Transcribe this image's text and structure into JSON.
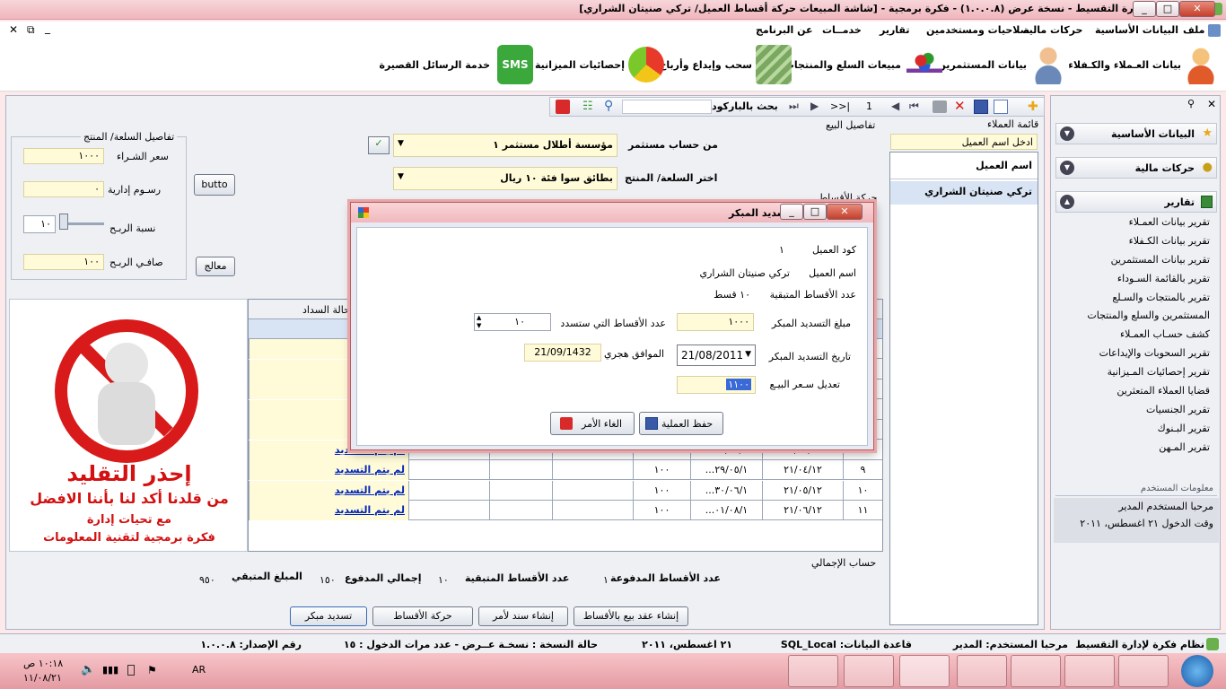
{
  "window": {
    "title": "نظام فكرة لإدارة التقسيط - نسخة عرض (١.٠.٠.٨) - فكرة برمجية - [شاشة المبيعات    حركة أقساط العميل/ تركي صنيتان الشراري]",
    "min": "_",
    "max": "□",
    "close": "✕"
  },
  "mdi_controls": {
    "close": "✕",
    "restore": "⧉",
    "min": "_"
  },
  "menu": [
    "ملف",
    "البيانات الأساسية",
    "حركات مالية",
    "صلاحيات ومستخدمين",
    "تقارير",
    "خدمــات",
    "عن البرنامج"
  ],
  "toolbar": [
    {
      "label": "بيانات العـملاء والكـفلاء",
      "icon": "customers-icon"
    },
    {
      "label": "بيانات المستثمرين",
      "icon": "investor-icon"
    },
    {
      "label": "مبيعات السلع والمنتجات",
      "icon": "cart-icon"
    },
    {
      "label": "سحب وإيداع وأرباح",
      "icon": "money-icon"
    },
    {
      "label": "إحصائيات الميزانية",
      "icon": "pie-chart-icon"
    },
    {
      "label": "خدمة الرسائل القصيرة",
      "icon": "sms-icon"
    }
  ],
  "panel_toolbar": {
    "barcode_label": "بحث بالباركود",
    "page_number": "1",
    "page_nav": ">>|"
  },
  "customers_list": {
    "title": "قائمة العملاء",
    "search_placeholder": "ادخل اسم العميل",
    "header": "اسم العميل",
    "selected": "تركي صنيتان الشراري"
  },
  "sale_details": {
    "title": "تفاصيل البيع",
    "investor_label": "من حساب مستثمر",
    "investor_value": "مؤسسة أطلال مستثمر ١",
    "product_label": "اختر السلعة/ المنتج",
    "product_value": "بطائق سوا فئة ١٠ ريال",
    "installments_movement": "حركة الأقساط"
  },
  "product_details": {
    "title": "تفاصيل السلعة/ المنتج",
    "purchase_price_label": "سعر الشـراء",
    "purchase_price": "١٠٠٠",
    "admin_fees_label": "رسـوم إدارية",
    "admin_fees": "٠",
    "profit_ratio_label": "نسبة الربـح",
    "profit_ratio": "١٠",
    "net_profit_label": "صافـي الربـح",
    "net_profit": "١٠٠",
    "button_label": "butto",
    "process_button": "معالج"
  },
  "warning": {
    "line1": "إحذر التقليد",
    "line2": "من قلدنا أكد لنا بأننا الافضل",
    "line3": "مع تحيات إدارة",
    "line4": "فكرة برمجية لتقنية المعلومات"
  },
  "grid": {
    "header_status": "حالة السداد",
    "rows": [
      {
        "status": "سديد",
        "amount": "",
        "date_h": "",
        "date_g": "",
        "num": ""
      },
      {
        "status": "سديد",
        "amount": "",
        "date_h": "",
        "date_g": "",
        "num": ""
      },
      {
        "status": "سديد",
        "amount": "",
        "date_h": "",
        "date_g": "",
        "num": ""
      },
      {
        "status": "سديد",
        "amount": "",
        "date_h": "",
        "date_g": "",
        "num": ""
      },
      {
        "status": "سديد",
        "amount": "",
        "date_h": "",
        "date_g": "",
        "num": ""
      },
      {
        "status": "لم يتم التسديد",
        "amount": "١٠٠",
        "date_h": "...٢٨/٠٤/١",
        "date_g": "٢١/٠٣/١٢",
        "num": "٨"
      },
      {
        "status": "لم يتم التسديد",
        "amount": "١٠٠",
        "date_h": "...٢٩/٠٥/١",
        "date_g": "٢١/٠٤/١٢",
        "num": "٩"
      },
      {
        "status": "لم يتم التسديد",
        "amount": "١٠٠",
        "date_h": "...٣٠/٠٦/١",
        "date_g": "٢١/٠٥/١٢",
        "num": "١٠"
      },
      {
        "status": "لم يتم التسديد",
        "amount": "١٠٠",
        "date_h": "...٠١/٠٨/١",
        "date_g": "٢١/٠٦/١٢",
        "num": "١١"
      }
    ]
  },
  "totals": {
    "title": "حساب الإجمالي",
    "paid_count_label": "عدد الأقساط المدفوعة",
    "paid_count": "١",
    "remaining_count_label": "عدد الأقساط المتبقية",
    "remaining_count": "١٠",
    "total_paid_label": "إجمالي المدفوع",
    "total_paid": "١٥٠",
    "remaining_amount_label": "المبلغ المتبقي",
    "remaining_amount": "٩٥٠"
  },
  "bottom_buttons": [
    "تسديد مبكر",
    "حركة الأقساط",
    "إنشاء سند لأمر",
    "إنشاء عقد بيع بالأقساط"
  ],
  "sidebar": {
    "sections": [
      {
        "title": "البيانات الأساسية",
        "icon": "star-icon"
      },
      {
        "title": "حركات مالية",
        "icon": "coins-icon"
      },
      {
        "title": "تقارير",
        "icon": "report-icon"
      }
    ],
    "reports": [
      "تقرير بيانات العمـلاء",
      "تقرير بيانات الكـفلاء",
      "تقرير بيانات المستثمرين",
      "تقرير بالقائمة السـوداء",
      "تقرير بالمنتجات والسـلع",
      "المستثمرين والسلع والمنتجات",
      "كشف حسـاب العمـلاء",
      "تقرير السحوبات والإيداعات",
      "تقرير إحصائيات المـيزانية",
      "قضايا العملاء المتعثرين",
      "تقرير الجنسيات",
      "تقرير البـنوك",
      "تقرير المـهن"
    ],
    "user_info_title": "معلومات المستخدم",
    "welcome": "مرحبا المستخدم المدير",
    "login_time": "وقت الدخول ٢١ اغسطس، ٢٠١١"
  },
  "statusbar": {
    "app": "نظام فكرة لإدارة التقسيط",
    "user": "مرحبا المستخدم: المدير",
    "db": "قاعدة البيانات: SQL_Local",
    "date": "٢١ اغسطس، ٢٠١١",
    "edition": "حالة النسخة : نسخـة عــرض - عدد مرات الدخول : ١٥",
    "version": "رقم الإصدار: ١.٠.٠.٨"
  },
  "dialog": {
    "title": "تسديد المبكر",
    "customer_code_label": "كود العميل",
    "customer_code": "١",
    "customer_name_label": "اسم العميل",
    "customer_name": "تركي صنيتان الشراري",
    "remaining_label": "عدد الأقساط المتبقية",
    "remaining_value": "١٠ قسط",
    "early_amount_label": "مبلغ التسديد المبكر",
    "early_amount": "١٠٠٠",
    "paid_installments_label": "عدد الأقساط التي ستسدد",
    "paid_installments": "١٠",
    "date_label": "تاريخ التسديد المبكر",
    "date_value": "21/08/2011",
    "hijri_label": "الموافق هجري",
    "hijri_value": "21/09/1432",
    "price_edit_label": "تعديل سـعر البيـع",
    "price_edit_value": "١١٠٠",
    "save_button": "حفظ العملية",
    "cancel_button": "الغاء الأمر"
  },
  "taskbar": {
    "time": "١٠:١٨ ص",
    "date": "١١/٠٨/٢١",
    "lang": "AR"
  }
}
